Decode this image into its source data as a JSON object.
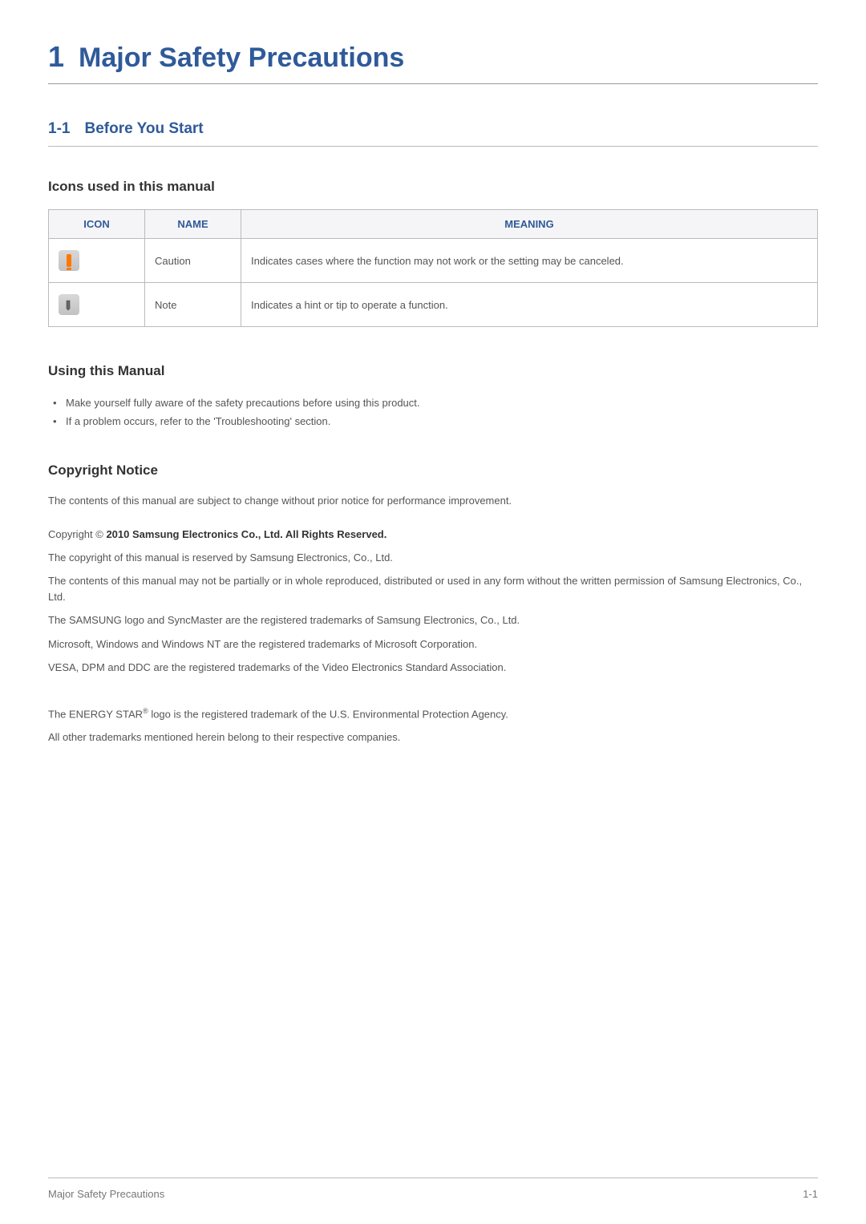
{
  "chapter": {
    "number": "1",
    "title": "Major Safety Precautions"
  },
  "section": {
    "number": "1-1",
    "title": "Before You Start"
  },
  "sub1": {
    "heading": "Icons used in this manual"
  },
  "table": {
    "headers": {
      "icon": "ICON",
      "name": "NAME",
      "meaning": "MEANING"
    },
    "rows": [
      {
        "name": "Caution",
        "meaning": "Indicates cases where the function may not work or the setting may be canceled."
      },
      {
        "name": "Note",
        "meaning": "Indicates a hint or tip to operate a function."
      }
    ]
  },
  "sub2": {
    "heading": "Using this Manual",
    "bullets": [
      "Make yourself fully aware of the safety precautions before using this product.",
      "If a problem occurs, refer to the 'Troubleshooting' section."
    ]
  },
  "sub3": {
    "heading": "Copyright Notice",
    "p1": "The contents of this manual are subject to change without prior notice for performance improvement.",
    "copyright_prefix": "Copyright © ",
    "copyright_bold": "2010 Samsung Electronics Co., Ltd. All Rights Reserved.",
    "p2": "The copyright of this manual is reserved by Samsung Electronics, Co., Ltd.",
    "p3": "The contents of this manual may not be partially or in whole reproduced, distributed or used in any form without the written permission of Samsung Electronics, Co., Ltd.",
    "p4": "The SAMSUNG logo and SyncMaster are the registered trademarks of Samsung Electronics, Co., Ltd.",
    "p5": "Microsoft, Windows and Windows NT are the registered trademarks of Microsoft Corporation.",
    "p6": "VESA, DPM and DDC are the registered trademarks of the Video Electronics Standard Association.",
    "p7_a": "The ENERGY STAR",
    "p7_sup": "®",
    "p7_b": " logo is the registered trademark of the U.S. Environmental Protection Agency.",
    "p8": "All other trademarks mentioned herein belong to their respective companies."
  },
  "footer": {
    "left": "Major Safety Precautions",
    "right": "1-1"
  }
}
